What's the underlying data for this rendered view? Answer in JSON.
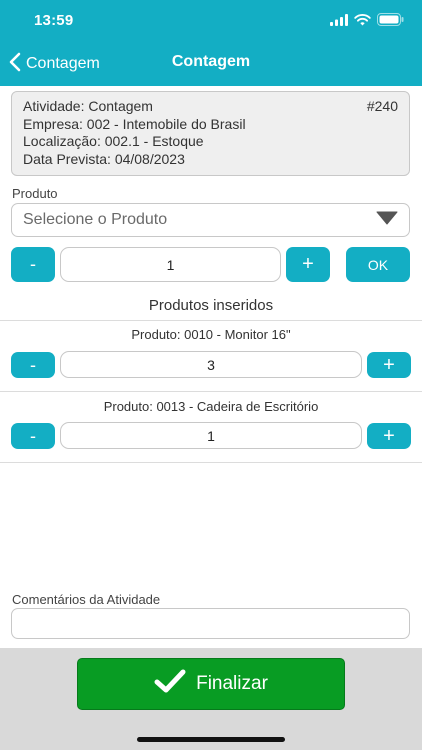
{
  "status_bar": {
    "time": "13:59"
  },
  "nav": {
    "back_label": "Contagem",
    "title": "Contagem"
  },
  "info": {
    "atividade": "Atividade: Contagem",
    "numero": "#240",
    "empresa": "Empresa: 002 - Intemobile do Brasil",
    "localizacao": "Localização: 002.1 - Estoque",
    "data_prevista": "Data Prevista: 04/08/2023"
  },
  "produto": {
    "label": "Produto",
    "placeholder": "Selecione o Produto",
    "quantity": "1",
    "minus": "-",
    "plus": "+",
    "ok": "OK"
  },
  "inserted": {
    "title": "Produtos inseridos",
    "items": [
      {
        "name": "Produto: 0010 - Monitor 16\"",
        "quantity": "3"
      },
      {
        "name": "Produto: 0013 - Cadeira de Escritório",
        "quantity": "1"
      }
    ]
  },
  "comments": {
    "label": "Comentários da Atividade",
    "value": ""
  },
  "footer": {
    "finalizar_label": "Finalizar"
  },
  "colors": {
    "accent": "#13aec4",
    "success": "#089c23",
    "footer_bg": "#d9d9d9",
    "info_bg": "#efefef"
  },
  "icons": [
    "chevron-left-icon",
    "signal-icon",
    "wifi-icon",
    "battery-icon",
    "dropdown-triangle-icon",
    "checkmark-icon"
  ]
}
